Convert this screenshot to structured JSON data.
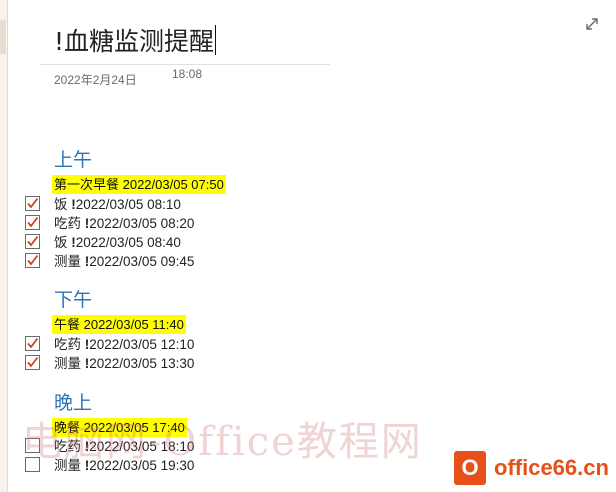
{
  "note": {
    "title": "!血糖监测提醒",
    "date": "2022年2月24日",
    "time": "18:08"
  },
  "sections": [
    {
      "heading": "上午",
      "meal": "第一次早餐 2022/03/05 07:50",
      "items": [
        {
          "label": "饭 ",
          "time": "2022/03/05 08:10",
          "checked": true
        },
        {
          "label": "吃药 ",
          "time": "2022/03/05 08:20",
          "checked": true
        },
        {
          "label": "饭 ",
          "time": "2022/03/05 08:40",
          "checked": true
        },
        {
          "label": "测量 ",
          "time": "2022/03/05 09:45",
          "checked": true
        }
      ]
    },
    {
      "heading": "下午",
      "meal": "午餐 2022/03/05 11:40",
      "items": [
        {
          "label": "吃药 ",
          "time": "2022/03/05 12:10",
          "checked": true
        },
        {
          "label": "测量 ",
          "time": "2022/03/05 13:30",
          "checked": true
        }
      ]
    },
    {
      "heading": "晚上",
      "meal": "晚餐 2022/03/05 17:40",
      "items": [
        {
          "label": "吃药 ",
          "time": "2022/03/05 18:10",
          "checked": false
        },
        {
          "label": "测量 ",
          "time": "2022/03/05 19:30",
          "checked": false
        }
      ]
    }
  ],
  "reminder_mark": "!",
  "watermark": {
    "text": "电脑网-Office教程网",
    "logo_mark": "O",
    "logo_text": "office66.cn"
  },
  "colors": {
    "heading": "#2e74b5",
    "highlight": "#ffff00",
    "checkmark": "#d04020",
    "logo": "#e8501a"
  },
  "icons": {
    "expand": "expand-diagonal-icon",
    "checkbox_checked": "checkbox-checked-icon",
    "checkbox_empty": "checkbox-empty-icon"
  }
}
